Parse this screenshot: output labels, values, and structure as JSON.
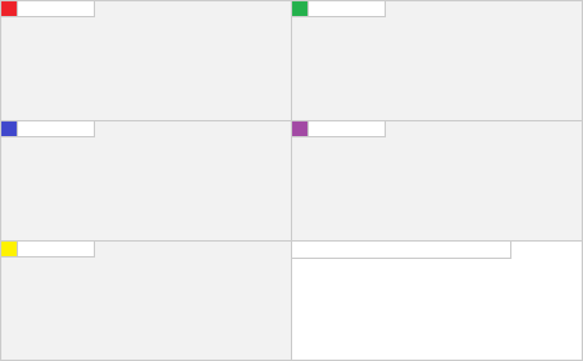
{
  "panels": [
    {
      "name_value": "",
      "color": "#ee2229"
    },
    {
      "name_value": "",
      "color": "#24b14c"
    },
    {
      "name_value": "",
      "color": "#3f47cc"
    },
    {
      "name_value": "",
      "color": "#a24aa4"
    },
    {
      "name_value": "",
      "color": "#fef200"
    }
  ],
  "extra": {
    "field_value": ""
  }
}
